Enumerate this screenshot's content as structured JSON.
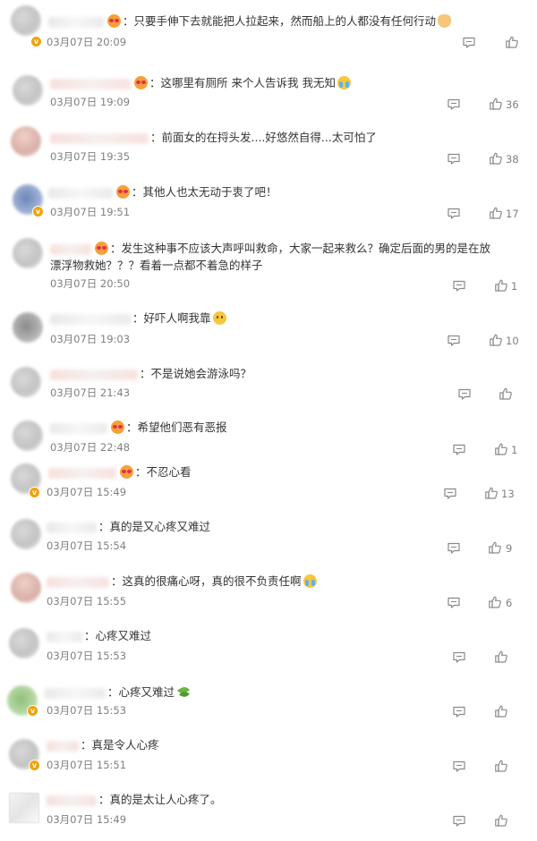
{
  "comments": [
    {
      "text": "：只要手伸下去就能把人拉起来，然而船上的人都没有任何行动",
      "time": "03月07日 20:09",
      "likes": ""
    },
    {
      "text": "：这哪里有厕所 来个人告诉我 我无知",
      "time": "03月07日 19:09",
      "likes": "36"
    },
    {
      "text": "：前面女的在捋头发....好悠然自得...太可怕了",
      "time": "03月07日 19:35",
      "likes": "38"
    },
    {
      "text": "：其他人也太无动于衷了吧！",
      "time": "03月07日 19:51",
      "likes": "17"
    },
    {
      "text": "：发生这种事不应该大声呼叫救命，大家一起来救么？确定后面的男的是在放漂浮物救她？？？看着一点都不着急的样子",
      "time": "03月07日 20:50",
      "likes": "1"
    },
    {
      "text": "：好吓人啊我靠",
      "time": "03月07日 19:03",
      "likes": "10"
    },
    {
      "text": "：不是说她会游泳吗？",
      "time": "03月07日 21:43",
      "likes": ""
    },
    {
      "text": "：希望他们恶有恶报",
      "time": "03月07日 22:48",
      "likes": "1"
    },
    {
      "text": "：不忍心看",
      "time": "03月07日 15:49",
      "likes": "13"
    },
    {
      "text": "：真的是又心疼又难过",
      "time": "03月07日 15:54",
      "likes": "9"
    },
    {
      "text": "：这真的很痛心呀，真的很不负责任啊",
      "time": "03月07日 15:55",
      "likes": "6"
    },
    {
      "text": "：心疼又难过",
      "time": "03月07日 15:53",
      "likes": ""
    },
    {
      "text": "：心疼又难过",
      "time": "03月07日 15:53",
      "likes": ""
    },
    {
      "text": "：真是令人心疼",
      "time": "03月07日 15:51",
      "likes": ""
    },
    {
      "text": "：真的是太让人心疼了。",
      "time": "03月07日 15:49",
      "likes": ""
    }
  ],
  "icons": {
    "reply": "comment-bubble-icon",
    "like": "thumbs-up-icon",
    "emoji_red": "red-heart-eyes-emoji-icon",
    "emoji_yellow": "smiley-emoji-icon",
    "emoji_cry": "crying-emoji-icon",
    "emoji_leaf": "leaf-emoji-icon",
    "emoji_cat": "cat-emoji-icon",
    "verified": "verified-badge-icon"
  },
  "colors": {
    "text": "#333333",
    "meta": "#808080",
    "verified_badge": "#f0a30a"
  }
}
